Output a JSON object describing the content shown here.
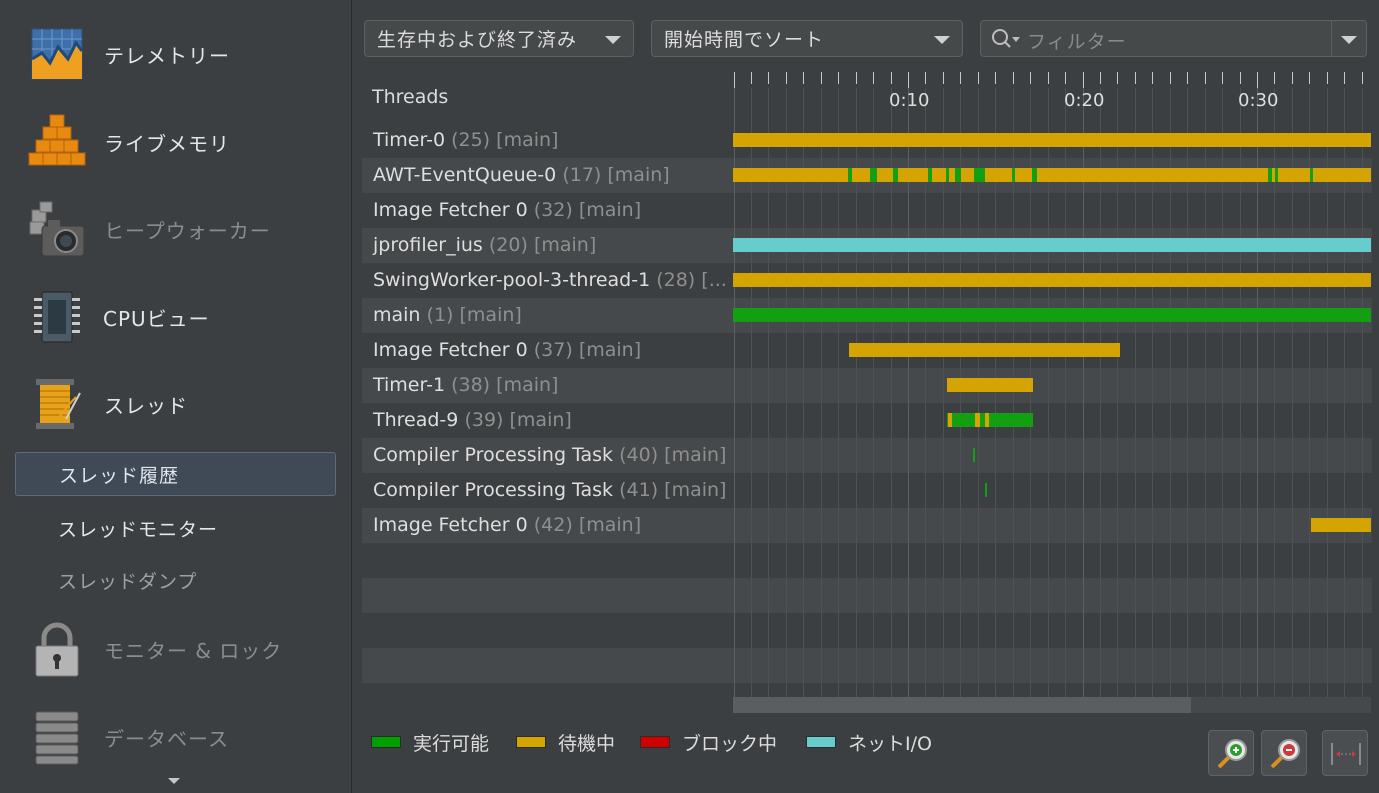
{
  "sidebar": {
    "items": [
      {
        "label": "テレメトリー",
        "icon": "telemetry-icon"
      },
      {
        "label": "ライブメモリ",
        "icon": "live-memory-icon"
      },
      {
        "label": "ヒープウォーカー",
        "icon": "heap-walker-icon"
      },
      {
        "label": "CPUビュー",
        "icon": "cpu-view-icon"
      },
      {
        "label": "スレッド",
        "icon": "threads-icon"
      },
      {
        "label": "モニター & ロック",
        "icon": "lock-icon"
      },
      {
        "label": "データベース",
        "icon": "database-icon"
      }
    ],
    "sub_items": [
      {
        "label": "スレッド履歴"
      },
      {
        "label": "スレッドモニター"
      },
      {
        "label": "スレッドダンプ"
      }
    ]
  },
  "toolbar": {
    "thread_filter_value": "生存中および終了済み",
    "sort_value": "開始時間でソート",
    "filter_placeholder": "フィルター"
  },
  "table": {
    "header": "Threads",
    "time_labels": [
      "0:10",
      "0:20",
      "0:30"
    ],
    "rows": [
      {
        "name": "Timer-0",
        "id": "(25)",
        "group": "[main]"
      },
      {
        "name": "AWT-EventQueue-0",
        "id": "(17)",
        "group": "[main]"
      },
      {
        "name": "Image Fetcher 0",
        "id": "(32)",
        "group": "[main]"
      },
      {
        "name": "jprofiler_ius",
        "id": "(20)",
        "group": "[main]"
      },
      {
        "name": "SwingWorker-pool-3-thread-1",
        "id": "(28)",
        "group": "[..."
      },
      {
        "name": "main",
        "id": "(1)",
        "group": "[main]"
      },
      {
        "name": "Image Fetcher 0",
        "id": "(37)",
        "group": "[main]"
      },
      {
        "name": "Timer-1",
        "id": "(38)",
        "group": "[main]"
      },
      {
        "name": "Thread-9",
        "id": "(39)",
        "group": "[main]"
      },
      {
        "name": "Compiler Processing Task",
        "id": "(40)",
        "group": "[main]"
      },
      {
        "name": "Compiler Processing Task",
        "id": "(41)",
        "group": "[main]"
      },
      {
        "name": "Image Fetcher 0",
        "id": "(42)",
        "group": "[main]"
      }
    ]
  },
  "legend": [
    {
      "label": "実行可能",
      "color": "#00a000"
    },
    {
      "label": "待機中",
      "color": "#d4a600"
    },
    {
      "label": "ブロック中",
      "color": "#d00000"
    },
    {
      "label": "ネットI/O",
      "color": "#66cccc"
    }
  ],
  "colors": {
    "runnable": "#12a012",
    "waiting": "#d4a402",
    "net_io": "#66cccc"
  }
}
